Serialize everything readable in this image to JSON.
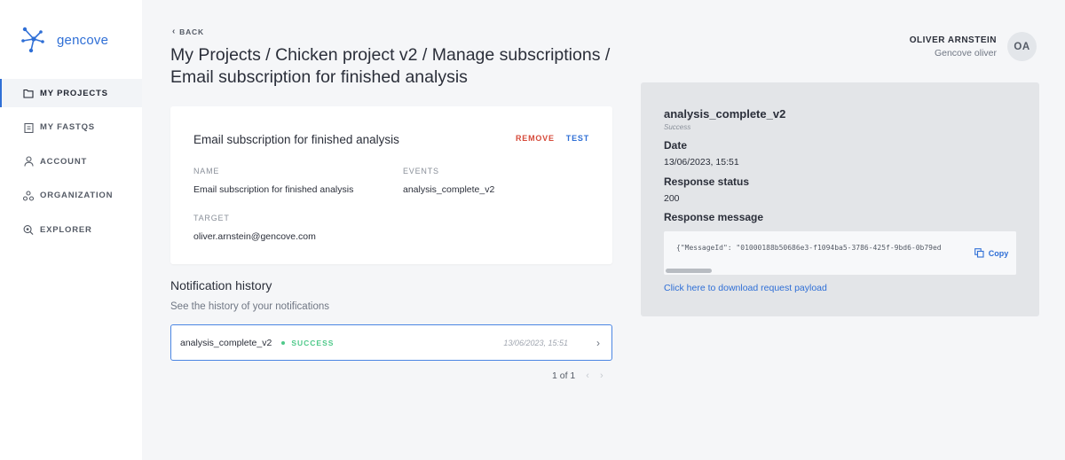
{
  "brand": {
    "name": "gencove"
  },
  "sidebar": {
    "items": [
      {
        "label": "MY PROJECTS",
        "icon": "folder-icon",
        "active": true
      },
      {
        "label": "MY FASTQS",
        "icon": "clipboard-icon",
        "active": false
      },
      {
        "label": "ACCOUNT",
        "icon": "user-icon",
        "active": false
      },
      {
        "label": "ORGANIZATION",
        "icon": "organization-icon",
        "active": false
      },
      {
        "label": "EXPLORER",
        "icon": "explorer-icon",
        "active": false
      }
    ]
  },
  "header": {
    "back_label": "BACK",
    "title": "My Projects / Chicken project v2 / Manage subscriptions / Email subscription for finished analysis"
  },
  "user": {
    "name": "OLIVER ARNSTEIN",
    "org": "Gencove oliver",
    "initials": "OA"
  },
  "subscription": {
    "title": "Email subscription for finished analysis",
    "remove_label": "REMOVE",
    "test_label": "TEST",
    "name_label": "NAME",
    "name_value": "Email subscription for finished analysis",
    "events_label": "EVENTS",
    "events_value": "analysis_complete_v2",
    "target_label": "TARGET",
    "target_value": "oliver.arnstein@gencove.com"
  },
  "history": {
    "title": "Notification history",
    "subtitle": "See the history of your notifications",
    "rows": [
      {
        "event": "analysis_complete_v2",
        "status": "SUCCESS",
        "date": "13/06/2023, 15:51"
      }
    ],
    "pager": {
      "text": "1 of 1"
    }
  },
  "detail": {
    "title": "analysis_complete_v2",
    "status": "Success",
    "date_label": "Date",
    "date_value": "13/06/2023, 15:51",
    "response_status_label": "Response status",
    "response_status_value": "200",
    "response_message_label": "Response message",
    "response_message": "{\"MessageId\": \"01000188b50686e3-f1094ba5-3786-425f-9bd6-0b79ed",
    "copy_label": "Copy",
    "download_label": "Click here to download request payload"
  },
  "colors": {
    "accent": "#2f6fd6",
    "danger": "#d64a3a",
    "success": "#4fc98a"
  }
}
